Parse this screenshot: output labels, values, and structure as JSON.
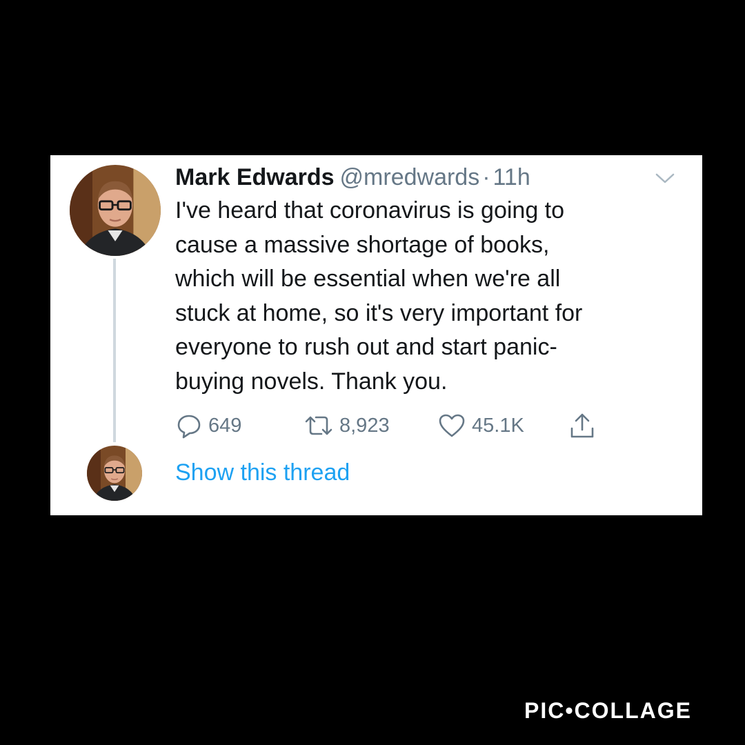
{
  "tweet": {
    "author_name": "Mark Edwards",
    "handle": "@mredwards",
    "separator": "·",
    "time": "11h",
    "text_lines": [
      "I've heard that coronavirus is going to",
      "cause a massive shortage of books,",
      "which will be essential when we're all",
      "stuck at home, so it's very important for",
      "everyone to rush out and start panic-",
      "buying novels. Thank you."
    ],
    "actions": {
      "reply_count": "649",
      "retweet_count": "8,923",
      "like_count": "45.1K"
    },
    "show_thread_label": "Show this thread"
  },
  "icons": {
    "menu": "chevron-down-icon",
    "reply": "reply-icon",
    "retweet": "retweet-icon",
    "like": "heart-icon",
    "share": "share-icon"
  },
  "colors": {
    "background": "#000000",
    "card": "#ffffff",
    "text_primary": "#14171a",
    "text_secondary": "#657786",
    "link": "#1da1f2",
    "thread_line": "#cfd8de"
  },
  "watermark": "PIC•COLLAGE"
}
